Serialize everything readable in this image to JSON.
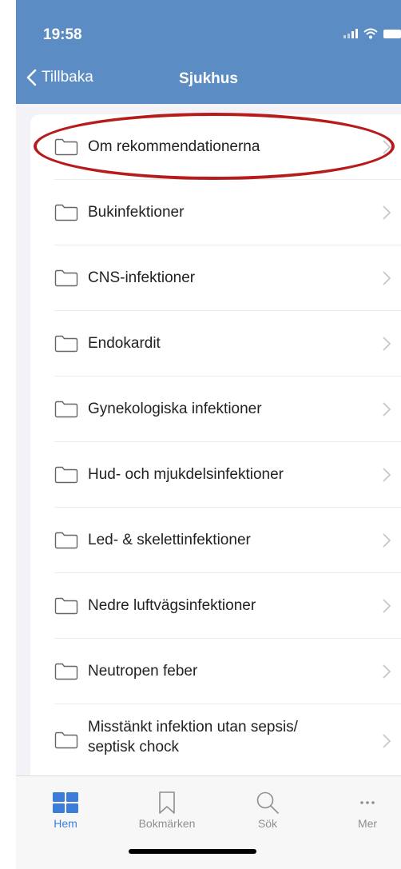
{
  "status": {
    "time": "19:58"
  },
  "nav": {
    "back_label": "Tillbaka",
    "title": "Sjukhus"
  },
  "list": {
    "items": [
      {
        "label": "Om rekommendationerna",
        "highlighted": true
      },
      {
        "label": "Bukinfektioner"
      },
      {
        "label": "CNS-infektioner"
      },
      {
        "label": "Endokardit"
      },
      {
        "label": "Gynekologiska infektioner"
      },
      {
        "label": "Hud- och mjukdelsinfektioner"
      },
      {
        "label": "Led- & skelettinfektioner"
      },
      {
        "label": "Nedre luftvägsinfektioner"
      },
      {
        "label": "Neutropen feber"
      },
      {
        "label": "Misstänkt infektion utan sepsis/ septisk chock"
      }
    ],
    "icon": "folder-icon",
    "trailing_icon": "chevron-right-icon"
  },
  "tabs": [
    {
      "label": "Hem",
      "icon": "grid-icon",
      "active": true
    },
    {
      "label": "Bokmärken",
      "icon": "bookmark-icon"
    },
    {
      "label": "Sök",
      "icon": "search-icon"
    },
    {
      "label": "Mer",
      "icon": "more-icon"
    }
  ],
  "colors": {
    "header": "#5b8cc3",
    "accent": "#3b7dd8",
    "highlight_ellipse": "#b71c1c",
    "background": "#f2f2f7"
  }
}
